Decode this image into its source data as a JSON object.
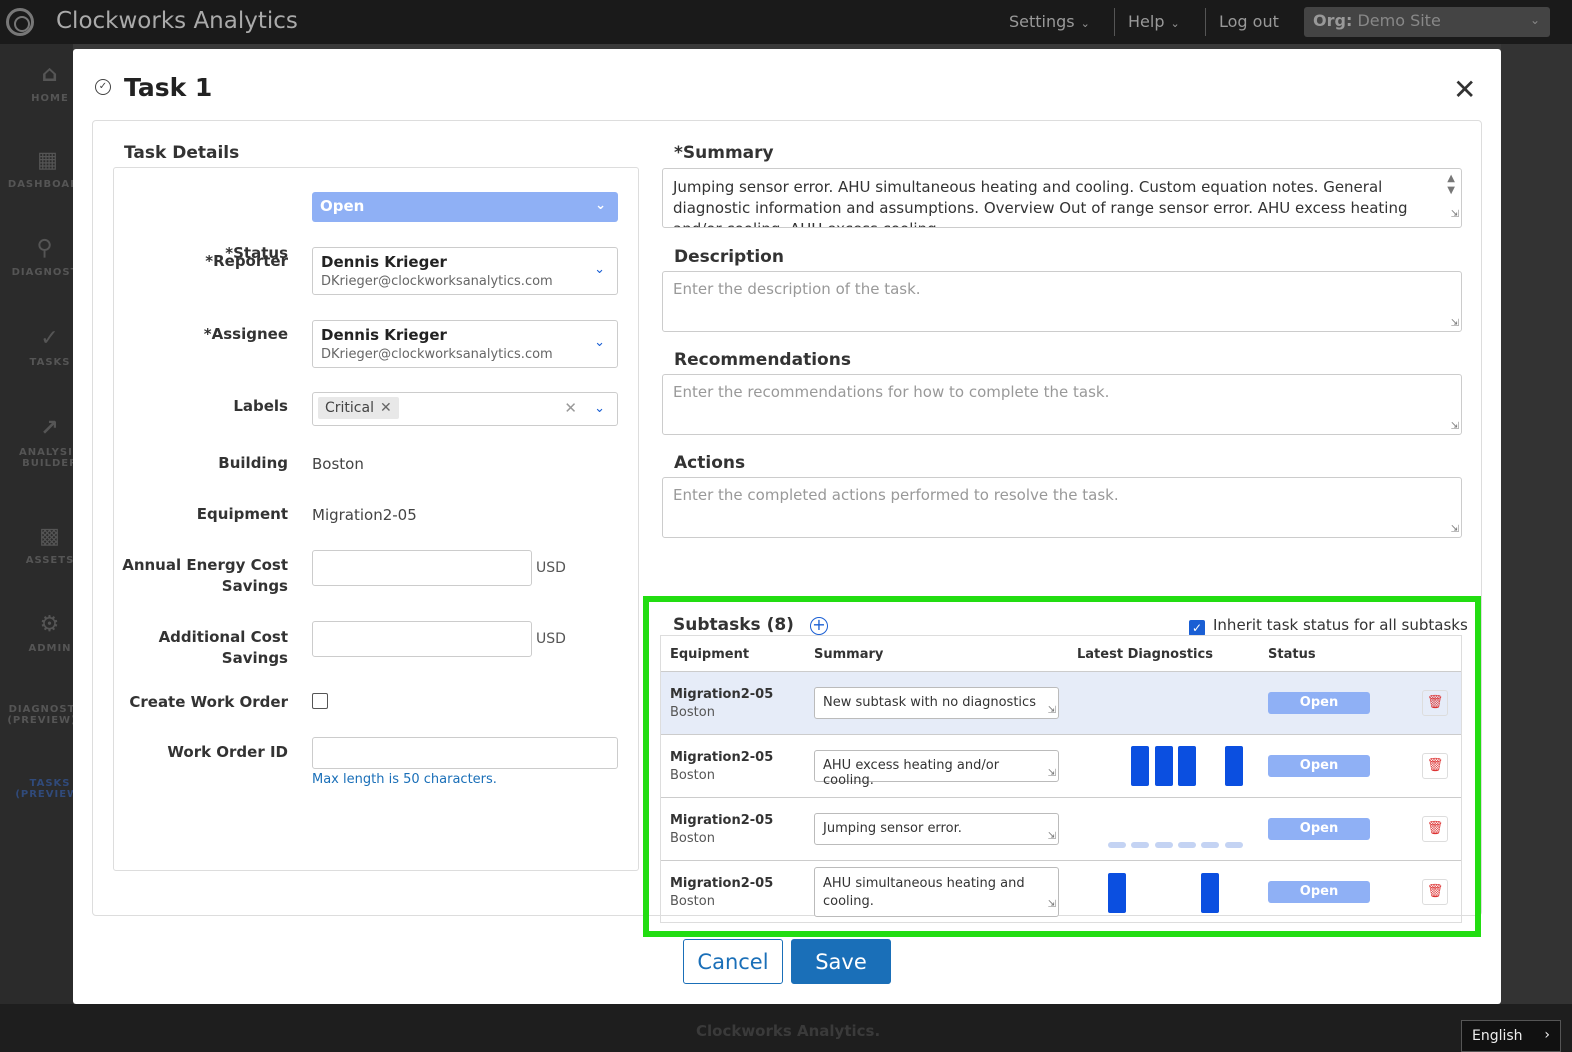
{
  "topbar": {
    "brand": "Clockworks Analytics",
    "settings": "Settings",
    "help": "Help",
    "logout": "Log out",
    "org_label": "Org:",
    "org_value": "Demo Site"
  },
  "leftnav": {
    "items": [
      {
        "label": "HOME",
        "icon": "home-icon"
      },
      {
        "label": "DASHBOARD",
        "icon": "dashboard-icon"
      },
      {
        "label": "DIAGNOST",
        "icon": "diagnostics-icon"
      },
      {
        "label": "TASKS",
        "icon": "tasks-icon"
      },
      {
        "label": "ANALYSIS BUILDER",
        "icon": "analysis-icon"
      },
      {
        "label": "ASSETS",
        "icon": "assets-icon"
      },
      {
        "label": "ADMIN",
        "icon": "admin-icon"
      },
      {
        "label": "DIAGNOST (PREVIEW)",
        "icon": ""
      },
      {
        "label": "TASKS (PREVIEW)",
        "icon": ""
      }
    ]
  },
  "modal": {
    "title": "Task 1",
    "details": {
      "heading": "Task Details",
      "status_label": "*Status",
      "status_value": "Open",
      "reporter_label": "*Reporter",
      "reporter_name": "Dennis Krieger",
      "reporter_email": "DKrieger@clockworksanalytics.com",
      "assignee_label": "*Assignee",
      "assignee_name": "Dennis Krieger",
      "assignee_email": "DKrieger@clockworksanalytics.com",
      "labels_label": "Labels",
      "label_chip": "Critical",
      "building_label": "Building",
      "building_value": "Boston",
      "equipment_label": "Equipment",
      "equipment_value": "Migration2-05",
      "annual_label_1": "Annual Energy Cost",
      "annual_label_2": "Savings",
      "additional_label_1": "Additional Cost",
      "additional_label_2": "Savings",
      "currency": "USD",
      "work_order_label": "Create Work Order",
      "work_order_id_label": "Work Order ID",
      "max_length_hint": "Max length is 50 characters."
    },
    "summary": {
      "label": "*Summary",
      "value": "Jumping sensor error. AHU simultaneous heating and cooling. Custom equation notes. General diagnostic information and assumptions. Overview Out of range sensor error. AHU excess heating and/or cooling. AHU excess cooling"
    },
    "description": {
      "label": "Description",
      "placeholder": "Enter the description of the task."
    },
    "recommendations": {
      "label": "Recommendations",
      "placeholder": "Enter the recommendations for how to complete the task."
    },
    "actions": {
      "label": "Actions",
      "placeholder": "Enter the completed actions performed to resolve the task."
    },
    "subtasks": {
      "title": "Subtasks (8)",
      "inherit_label": "Inherit task status for all subtasks",
      "columns": [
        "Equipment",
        "Summary",
        "Latest Diagnostics",
        "Status"
      ],
      "rows": [
        {
          "equipment": "Migration2-05",
          "building": "Boston",
          "summary": "New subtask with no diagnostics",
          "status": "Open"
        },
        {
          "equipment": "Migration2-05",
          "building": "Boston",
          "summary": "AHU excess heating and/or cooling.",
          "status": "Open"
        },
        {
          "equipment": "Migration2-05",
          "building": "Boston",
          "summary": "Jumping sensor error.",
          "status": "Open"
        },
        {
          "equipment": "Migration2-05",
          "building": "Boston",
          "summary": "AHU simultaneous heating and cooling.",
          "status": "Open"
        }
      ]
    },
    "cancel": "Cancel",
    "save": "Save"
  },
  "footer": {
    "brand": "Clockworks Analytics.",
    "language": "English"
  },
  "colors": {
    "accent": "#1a6fb8",
    "status_fill": "#8fb0f5",
    "diag_bar": "#0b4fe0",
    "highlight": "#22dd11"
  }
}
